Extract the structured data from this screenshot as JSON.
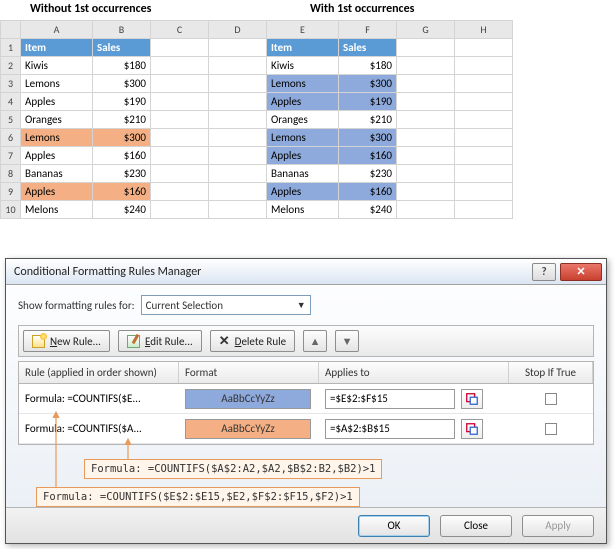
{
  "titles": {
    "without": "Without 1st occurrences",
    "with": "With 1st occurrences"
  },
  "columns": [
    "A",
    "B",
    "C",
    "D",
    "E",
    "F",
    "G",
    "H"
  ],
  "rows": [
    {
      "n": "1",
      "A": "Item",
      "B": "Sales",
      "E": "Item",
      "F": "Sales",
      "hdr": true
    },
    {
      "n": "2",
      "A": "Kiwis",
      "B": "$180",
      "E": "Kiwis",
      "F": "$180"
    },
    {
      "n": "3",
      "A": "Lemons",
      "B": "$300",
      "E": "Lemons",
      "F": "$300",
      "blE": true,
      "blF": true
    },
    {
      "n": "4",
      "A": "Apples",
      "B": "$190",
      "E": "Apples",
      "F": "$190",
      "blE": true,
      "blF": true
    },
    {
      "n": "5",
      "A": "Oranges",
      "B": "$210",
      "E": "Oranges",
      "F": "$210"
    },
    {
      "n": "6",
      "A": "Lemons",
      "B": "$300",
      "E": "Lemons",
      "F": "$300",
      "orA": true,
      "orB": true,
      "blE": true,
      "blF": true
    },
    {
      "n": "7",
      "A": "Apples",
      "B": "$160",
      "E": "Apples",
      "F": "$160",
      "blE": true,
      "blF": true
    },
    {
      "n": "8",
      "A": "Bananas",
      "B": "$230",
      "E": "Bananas",
      "F": "$230"
    },
    {
      "n": "9",
      "A": "Apples",
      "B": "$160",
      "E": "Apples",
      "F": "$160",
      "orA": true,
      "orB": true,
      "blE": true,
      "blF": true
    },
    {
      "n": "10",
      "A": "Melons",
      "B": "$240",
      "E": "Melons",
      "F": "$240"
    }
  ],
  "dialog": {
    "title": "Conditional Formatting Rules Manager",
    "showLabel": "Show formatting rules for:",
    "selectValue": "Current Selection",
    "buttons": {
      "new": "New Rule...",
      "edit": "Edit Rule...",
      "del": "Delete Rule"
    },
    "headers": {
      "rule": "Rule (applied in order shown)",
      "format": "Format",
      "applies": "Applies to",
      "stop": "Stop If True"
    },
    "rules": [
      {
        "text": "Formula: =COUNTIFS($E...",
        "applies": "=$E$2:$F$15",
        "preview": "AaBbCcYyZz",
        "fill": "#8ea9db"
      },
      {
        "text": "Formula: =COUNTIFS($A...",
        "applies": "=$A$2:$B$15",
        "preview": "AaBbCcYyZz",
        "fill": "#f4b084"
      }
    ],
    "footer": {
      "ok": "OK",
      "close": "Close",
      "apply": "Apply"
    }
  },
  "callouts": {
    "c1": "Formula: =COUNTIFS($A$2:A2,$A2,$B$2:B2,$B2)>1",
    "c2": "Formula: =COUNTIFS($E$2:$E15,$E2,$F$2:$F15,$F2)>1"
  }
}
